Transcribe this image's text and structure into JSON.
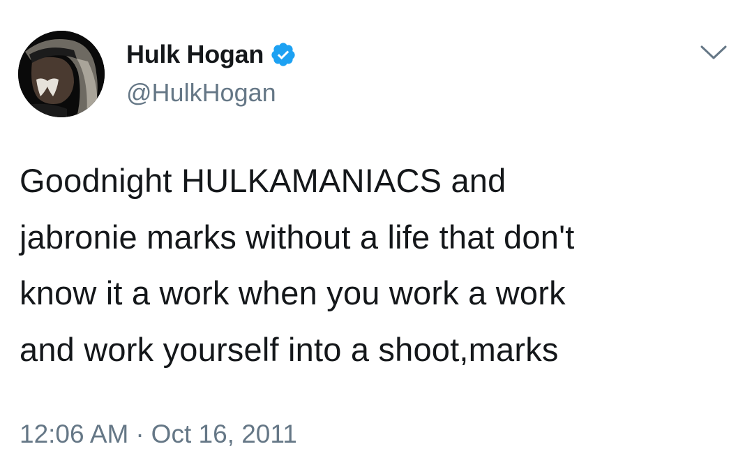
{
  "tweet": {
    "author": {
      "display_name": "Hulk Hogan",
      "handle": "@HulkHogan",
      "verified": true,
      "avatar_icon": "profile-photo",
      "verified_icon": "verified-badge-icon"
    },
    "menu_icon": "chevron-down-icon",
    "text_lines": [
      "Goodnight HULKAMANIACS and",
      "jabronie marks without a life that don't",
      "know it a work when you work a work",
      "and work yourself into a shoot,marks"
    ],
    "time": "12:06 AM",
    "separator": "·",
    "date": "Oct 16, 2011"
  },
  "colors": {
    "text": "#14171a",
    "secondary": "#657786",
    "verified": "#1da1f2",
    "background": "#ffffff"
  }
}
